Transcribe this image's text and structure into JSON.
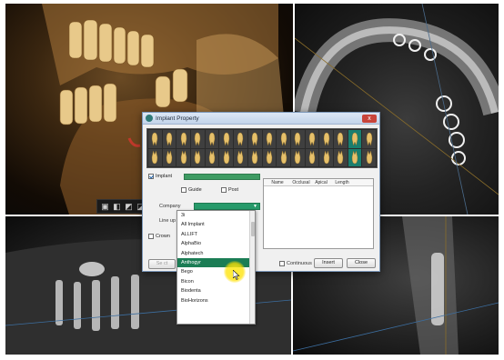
{
  "dialog": {
    "title": "Implant Property",
    "close_label": "x"
  },
  "tooth_grid": {
    "rows": 2,
    "columns": 16,
    "selected": [
      14,
      30
    ],
    "selected_color": "#1a7e6e"
  },
  "form": {
    "implant_label": "Implant",
    "implant_checked": true,
    "guide_label": "Guide",
    "post_label": "Post",
    "company_label": "Company",
    "lineup_label": "Line up",
    "crown_label": "Crown"
  },
  "table": {
    "columns": [
      "Name",
      "Occlusal",
      "Apical",
      "Length",
      ""
    ]
  },
  "buttons": {
    "left_partial": "Se ct",
    "continuous_label": "Continuous",
    "insert_label": "Insert",
    "close_label": "Close"
  },
  "dropdown": {
    "items": [
      "3i",
      "All Implant",
      "ALLIFT",
      "AlphaBio",
      "Alphatech",
      "Anthogyr",
      "Bego",
      "Bicon",
      "Biodenta",
      "BioHorizons"
    ],
    "highlighted_index": 5,
    "highlight_color": "#1b7d55"
  },
  "accent": {
    "green": "#3e9b63",
    "highlight_yellow": "#ffe600"
  }
}
